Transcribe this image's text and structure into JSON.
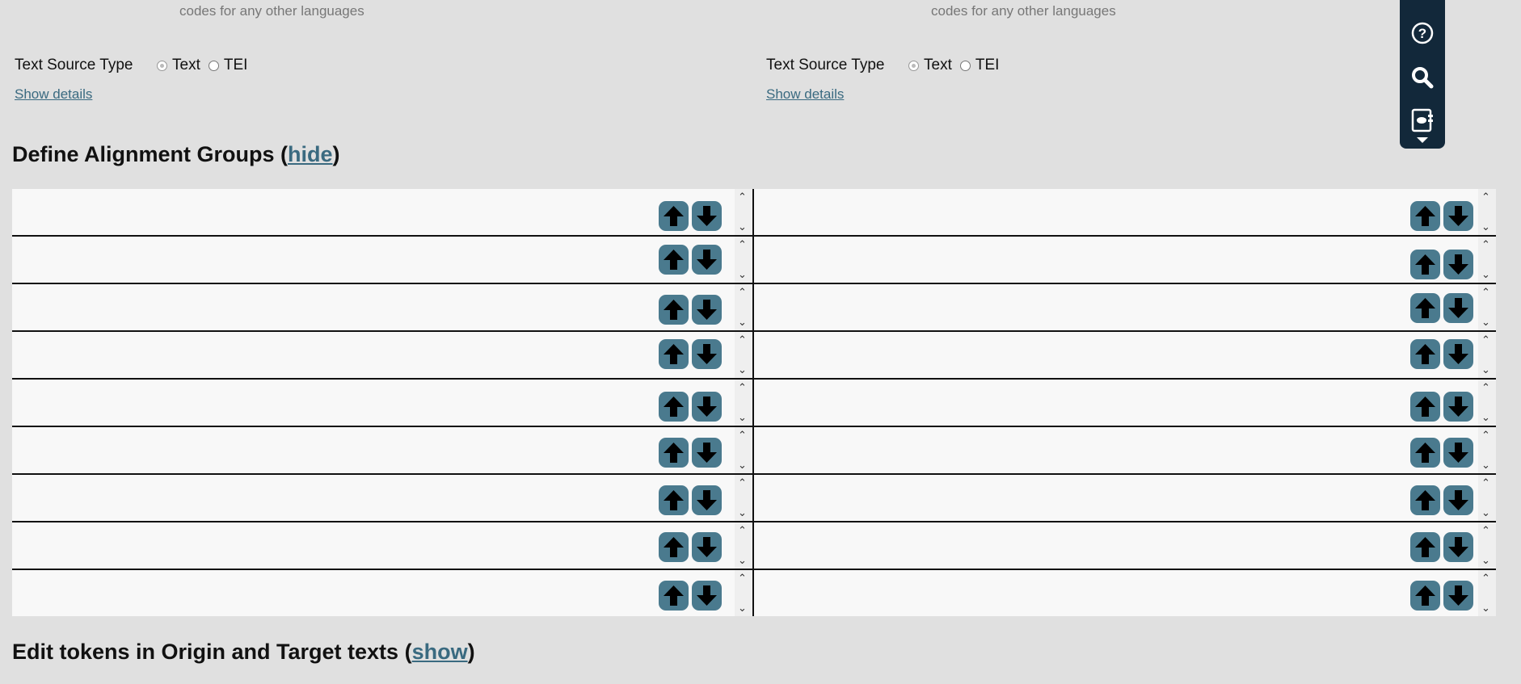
{
  "source_panels": [
    {
      "hint": "codes for any other languages",
      "text_source_type_label": "Text Source Type",
      "options": [
        {
          "label": "Text",
          "checked": true
        },
        {
          "label": "TEI",
          "checked": false
        }
      ],
      "show_details": "Show details"
    },
    {
      "hint": "codes for any other languages",
      "text_source_type_label": "Text Source Type",
      "options": [
        {
          "label": "Text",
          "checked": true
        },
        {
          "label": "TEI",
          "checked": false
        }
      ],
      "show_details": "Show details"
    }
  ],
  "alignment": {
    "title_prefix": "Define Alignment Groups (",
    "toggle": "hide",
    "title_suffix": ")",
    "row_count": 9
  },
  "tokens": {
    "title_prefix": "Edit tokens in Origin and Target texts (",
    "toggle": "show",
    "title_suffix": ")"
  },
  "toolbar": {
    "icons": [
      "help-icon",
      "search-icon",
      "book-icon"
    ]
  }
}
